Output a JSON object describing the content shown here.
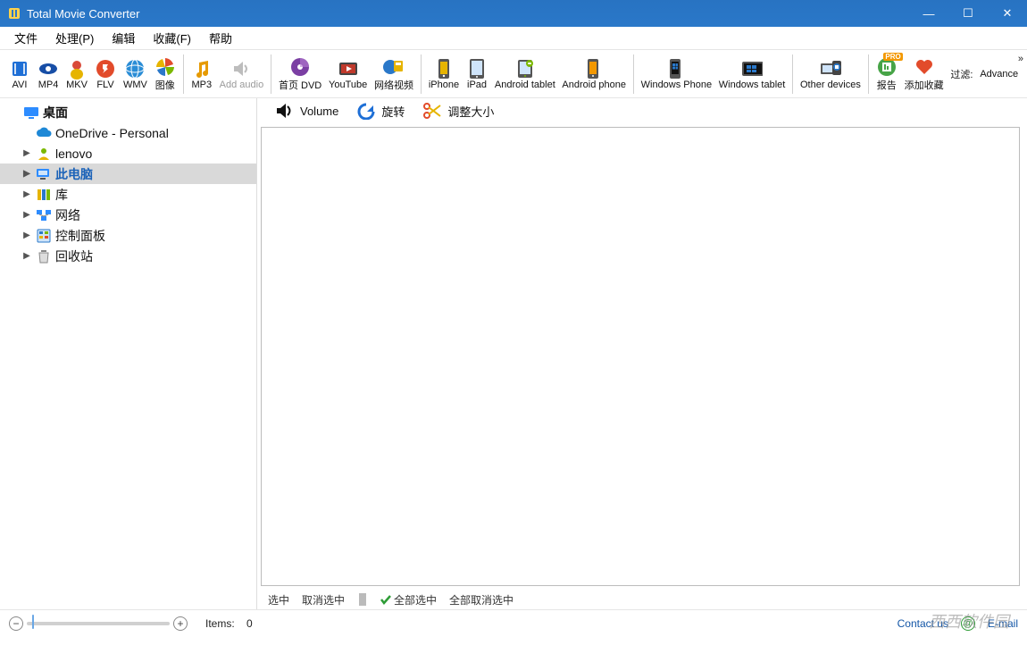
{
  "window": {
    "title": "Total Movie Converter",
    "controls": {
      "min": "—",
      "max": "☐",
      "close": "✕"
    }
  },
  "menubar": [
    {
      "id": "file",
      "label": "文件"
    },
    {
      "id": "process",
      "label": "处理(P)"
    },
    {
      "id": "edit",
      "label": "编辑"
    },
    {
      "id": "fav",
      "label": "收藏(F)"
    },
    {
      "id": "help",
      "label": "帮助"
    }
  ],
  "toolbar": [
    {
      "id": "avi",
      "label": "AVI",
      "icon": "film",
      "color": "#1e6fd6",
      "group": 1
    },
    {
      "id": "mp4",
      "label": "MP4",
      "icon": "eye",
      "color": "#174ea6",
      "group": 1
    },
    {
      "id": "mkv",
      "label": "MKV",
      "icon": "doll",
      "color": "#d94a3a",
      "group": 1
    },
    {
      "id": "flv",
      "label": "FLV",
      "icon": "flash",
      "color": "#e24b2b",
      "group": 1
    },
    {
      "id": "wmv",
      "label": "WMV",
      "icon": "globe",
      "color": "#2a8dd6",
      "group": 1
    },
    {
      "id": "image",
      "label": "图像",
      "icon": "pinwheel",
      "color": "#e6b400",
      "group": 1
    },
    {
      "id": "mp3",
      "label": "MP3",
      "icon": "music",
      "color": "#e69a00",
      "group": 2
    },
    {
      "id": "addaudio",
      "label": "Add audio",
      "icon": "speaker",
      "color": "#bdbdbd",
      "group": 2,
      "disabled": true
    },
    {
      "id": "dvd",
      "label": "首页 DVD",
      "icon": "disc",
      "color": "#7b3fa3",
      "group": 3
    },
    {
      "id": "youtube",
      "label": "YouTube",
      "icon": "tv",
      "color": "#c0392b",
      "group": 3
    },
    {
      "id": "netvideo",
      "label": "网络视频",
      "icon": "netglobe",
      "color": "#2a78c9",
      "group": 3
    },
    {
      "id": "iphone",
      "label": "iPhone",
      "icon": "phone",
      "color": "#555",
      "group": 4
    },
    {
      "id": "ipad",
      "label": "iPad",
      "icon": "tablet",
      "color": "#555",
      "group": 4
    },
    {
      "id": "atablet",
      "label": "Android tablet",
      "icon": "droidtab",
      "color": "#7bb800",
      "group": 4
    },
    {
      "id": "aphone",
      "label": "Android phone",
      "icon": "droidph",
      "color": "#f39800",
      "group": 4
    },
    {
      "id": "winphone",
      "label": "Windows Phone",
      "icon": "winph",
      "color": "#2a78c9",
      "group": 5
    },
    {
      "id": "wintablet",
      "label": "Windows tablet",
      "icon": "wintab",
      "color": "#2a78c9",
      "group": 5
    },
    {
      "id": "other",
      "label": "Other devices",
      "icon": "devices",
      "color": "#2a78c9",
      "group": 6
    },
    {
      "id": "report",
      "label": "报告",
      "icon": "report",
      "color": "#47a447",
      "group": 7,
      "pro": true
    },
    {
      "id": "filter",
      "label": "过滤:",
      "icon": "",
      "color": "#444",
      "group": 7,
      "plain": true
    }
  ],
  "toolbar_extra": {
    "favorite": {
      "label": "添加收藏",
      "icon": "heart"
    },
    "advance": {
      "label": "Advance"
    },
    "overflow": "»"
  },
  "side_tools": [
    {
      "id": "volume",
      "label": "Volume",
      "icon": "volume"
    },
    {
      "id": "rotate",
      "label": "旋转",
      "icon": "rotate"
    },
    {
      "id": "resize",
      "label": "调整大小",
      "icon": "scissors"
    }
  ],
  "tree": [
    {
      "id": "desktop",
      "label": "桌面",
      "icon": "monitor",
      "level": 0,
      "expand": ""
    },
    {
      "id": "onedrive",
      "label": "OneDrive - Personal",
      "icon": "cloud",
      "level": 1,
      "expand": ""
    },
    {
      "id": "lenovo",
      "label": "lenovo",
      "icon": "user",
      "level": 1,
      "expand": "▶"
    },
    {
      "id": "thispc",
      "label": "此电脑",
      "icon": "pc",
      "level": 1,
      "expand": "▶",
      "selected": true
    },
    {
      "id": "libs",
      "label": "库",
      "icon": "libs",
      "level": 1,
      "expand": "▶"
    },
    {
      "id": "network",
      "label": "网络",
      "icon": "net",
      "level": 1,
      "expand": "▶"
    },
    {
      "id": "cp",
      "label": "控制面板",
      "icon": "panel",
      "level": 1,
      "expand": "▶"
    },
    {
      "id": "recycle",
      "label": "回收站",
      "icon": "bin",
      "level": 1,
      "expand": "▶"
    }
  ],
  "selection_bar": {
    "select": "选中",
    "deselect": "取消选中",
    "selectall": "全部选中",
    "deselall": "全部取消选中"
  },
  "statusbar": {
    "items_label": "Items:",
    "items_count": "0",
    "contact": "Contact us",
    "email": "E-mail",
    "watermark": "西西软件园"
  }
}
